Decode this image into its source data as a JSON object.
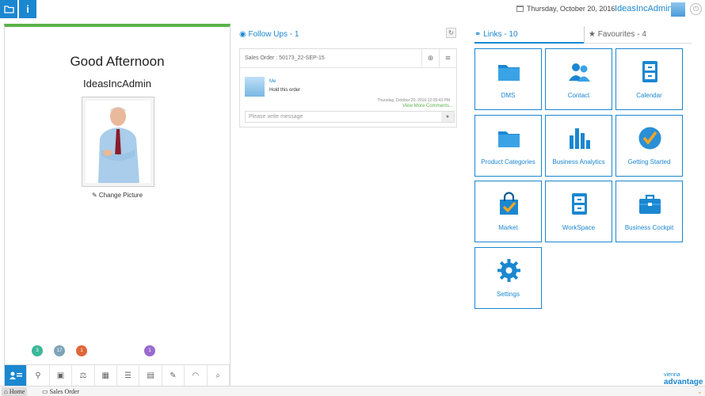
{
  "topbar": {
    "date": "Thursday, October 20, 2016",
    "user": "IdeasIncAdmin",
    "info_label": "i"
  },
  "left": {
    "greeting": "Good Afternoon",
    "username": "IdeasIncAdmin",
    "change_picture": "Change Picture",
    "badges": [
      {
        "count": "3",
        "color": "#3bb89a"
      },
      {
        "count": "17",
        "color": "#7fa3b8"
      },
      {
        "count": "1",
        "color": "#e0673a"
      },
      {
        "count": "1",
        "color": "#9a6ad0"
      }
    ]
  },
  "followups": {
    "title": "Follow Ups - 1",
    "header": "Sales Order : 50173_22-SEP-15",
    "sender": "Me",
    "message": "Hold this order",
    "timestamp": "Thursday, October 20, 2016 12:09:43 PM",
    "more": "View More Comments...",
    "placeholder": "Please write message"
  },
  "tabs": {
    "links": "Links - 10",
    "favourites": "Favourites - 4"
  },
  "tiles": [
    {
      "label": "DMS",
      "icon": "folder-icon"
    },
    {
      "label": "Contact",
      "icon": "contacts-icon"
    },
    {
      "label": "Calendar",
      "icon": "calendar-icon"
    },
    {
      "label": "Product Categories",
      "icon": "folder-icon"
    },
    {
      "label": "Business Analytics",
      "icon": "bar-chart-icon"
    },
    {
      "label": "Getting Started",
      "icon": "check-circle-icon"
    },
    {
      "label": "Market",
      "icon": "shopping-bag-icon"
    },
    {
      "label": "WorkSpace",
      "icon": "cabinet-icon"
    },
    {
      "label": "Business Cockpit",
      "icon": "briefcase-icon"
    },
    {
      "label": "Settings",
      "icon": "gear-icon"
    }
  ],
  "footer": {
    "home": "Home",
    "sales_order": "Sales Order"
  },
  "logo": {
    "top": "vienna",
    "bottom": "advantage"
  },
  "colors": {
    "accent": "#1b87d1",
    "green": "#5ab34a"
  }
}
